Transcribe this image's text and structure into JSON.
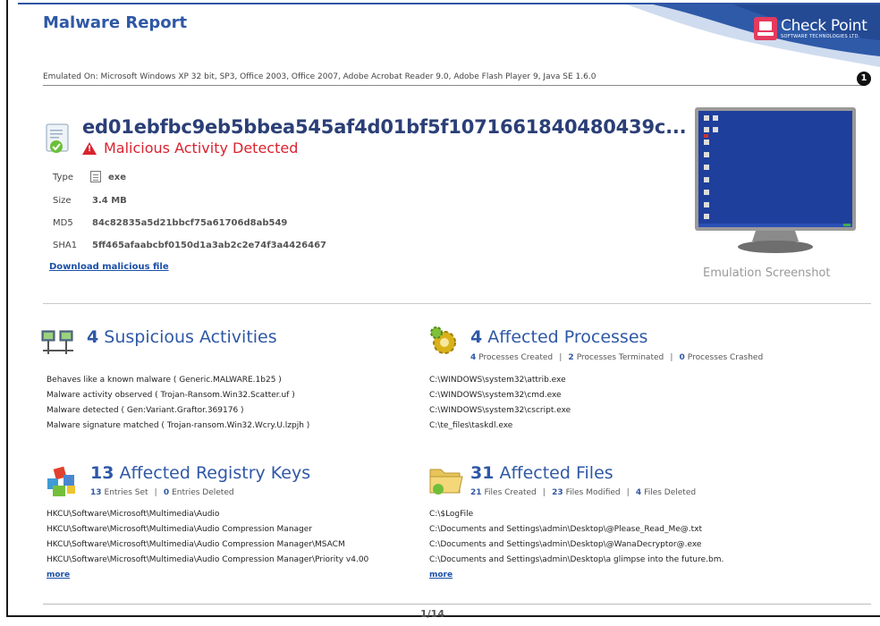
{
  "header": {
    "title": "Malware Report",
    "brand_name": "Check Point",
    "brand_sub": "SOFTWARE TECHNOLOGIES LTD.",
    "emulated_on": "Emulated On: Microsoft Windows XP 32 bit, SP3, Office 2003, Office 2007, Adobe Acrobat Reader 9.0, Adobe Flash Player 9, Java SE 1.6.0",
    "marker": "1"
  },
  "file": {
    "hash": "ed01ebfbc9eb5bbea545af4d01bf5f1071661840480439c...",
    "verdict": "Malicious Activity Detected",
    "type_label": "Type",
    "type_value": "exe",
    "size_label": "Size",
    "size_value": "3.4 MB",
    "md5_label": "MD5",
    "md5_value": "84c82835a5d21bbcf75a61706d8ab549",
    "sha1_label": "SHA1",
    "sha1_value": "5ff465afaabcbf0150d1a3ab2c2e74f3a4426467",
    "download_label": "Download malicious file",
    "screenshot_caption": "Emulation Screenshot"
  },
  "suspicious": {
    "count": "4",
    "title": "Suspicious Activities",
    "items": [
      "Behaves like a known malware ( Generic.MALWARE.1b25 )",
      "Malware activity observed ( Trojan-Ransom.Win32.Scatter.uf )",
      "Malware detected ( Gen:Variant.Graftor.369176 )",
      "Malware signature matched ( Trojan-ransom.Win32.Wcry.U.lzpjh )"
    ]
  },
  "processes": {
    "count": "4",
    "title": "Affected Processes",
    "created_num": "4",
    "created_label": "Processes Created",
    "terminated_num": "2",
    "terminated_label": "Processes Terminated",
    "crashed_num": "0",
    "crashed_label": "Processes Crashed",
    "items": [
      "C:\\WINDOWS\\system32\\attrib.exe",
      "C:\\WINDOWS\\system32\\cmd.exe",
      "C:\\WINDOWS\\system32\\cscript.exe",
      "C:\\te_files\\taskdl.exe"
    ]
  },
  "registry": {
    "count": "13",
    "title": "Affected Registry Keys",
    "set_num": "13",
    "set_label": "Entries Set",
    "deleted_num": "0",
    "deleted_label": "Entries Deleted",
    "items": [
      "HKCU\\Software\\Microsoft\\Multimedia\\Audio",
      "HKCU\\Software\\Microsoft\\Multimedia\\Audio Compression Manager",
      "HKCU\\Software\\Microsoft\\Multimedia\\Audio Compression Manager\\MSACM",
      "HKCU\\Software\\Microsoft\\Multimedia\\Audio Compression Manager\\Priority v4.00"
    ],
    "more": "more"
  },
  "files": {
    "count": "31",
    "title": "Affected Files",
    "created_num": "21",
    "created_label": "Files Created",
    "modified_num": "23",
    "modified_label": "Files Modified",
    "deleted_num": "4",
    "deleted_label": "Files Deleted",
    "items": [
      "C:\\$LogFile",
      "C:\\Documents and Settings\\admin\\Desktop\\@Please_Read_Me@.txt",
      "C:\\Documents and Settings\\admin\\Desktop\\@WanaDecryptor@.exe",
      "C:\\Documents and Settings\\admin\\Desktop\\a glimpse into the future.bm."
    ],
    "more": "more"
  },
  "footer": {
    "page": "1/14"
  }
}
